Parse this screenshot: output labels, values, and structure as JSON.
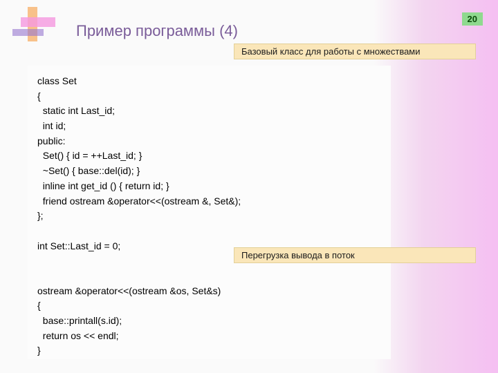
{
  "page_number": "20",
  "title": "Пример программы (4)",
  "callout_top": "Базовый класс для работы с множествами",
  "callout_mid": "Перегрузка вывода в поток",
  "code": "class Set\n{\n  static int Last_id;\n  int id;\npublic:\n  Set() { id = ++Last_id; }\n  ~Set() { base::del(id); }\n  inline int get_id () { return id; }\n  friend ostream &operator<<(ostream &, Set&);\n};\n\nint Set::Last_id = 0;\n\n\nostream &operator<<(ostream &os, Set&s)\n{\n  base::printall(s.id);\n  return os << endl;\n}"
}
